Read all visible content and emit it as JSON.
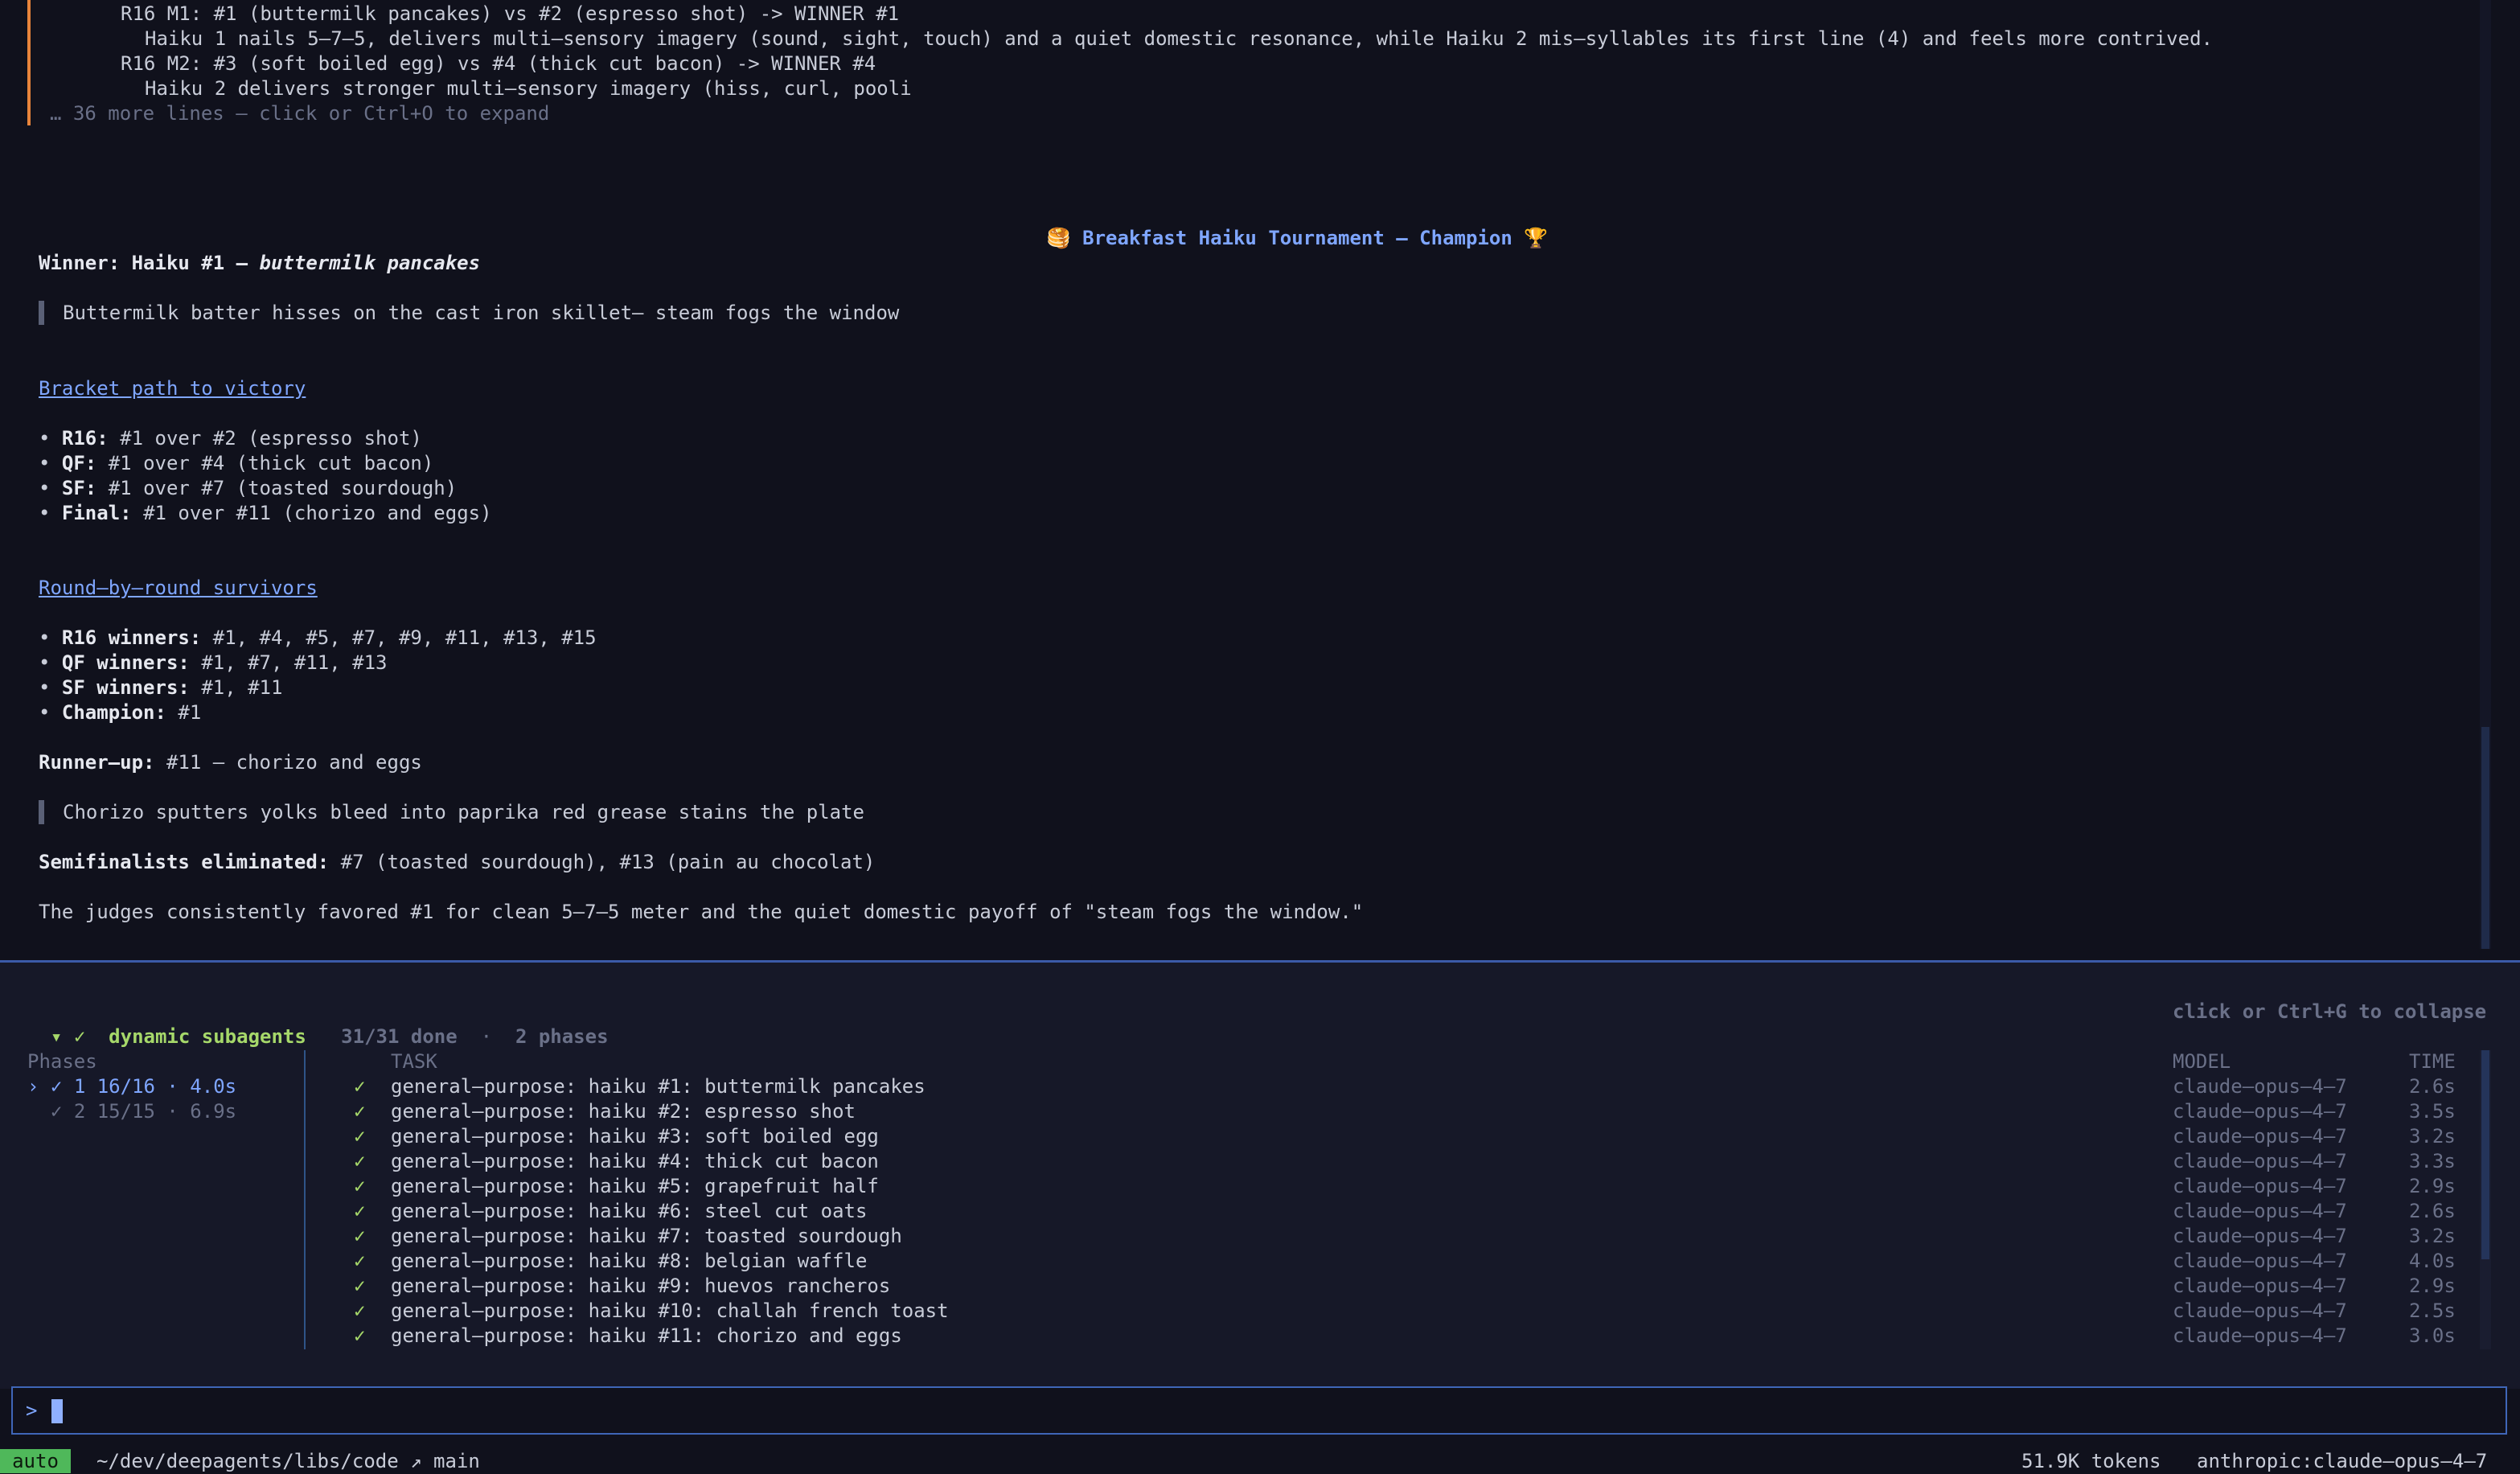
{
  "transcript": {
    "judge_lines": [
      "R16 M1: #1 (buttermilk pancakes) vs #2 (espresso shot) -> WINNER #1",
      "Haiku 1 nails 5–7–5, delivers multi–sensory imagery (sound, sight, touch) and a quiet domestic resonance, while Haiku 2 mis–syllables its first line (4) and feels more contrived.",
      "R16 M2: #3 (soft boiled egg) vs #4 (thick cut bacon) -> WINNER #4",
      "Haiku 2 delivers stronger multi–sensory imagery (hiss, curl, pooli"
    ],
    "collapsed_hint": "… 36 more lines — click or Ctrl+O to expand",
    "title_icon_left": "🥞",
    "title": "Breakfast Haiku Tournament — Champion",
    "title_icon_right": "🏆",
    "winner_label": "Winner: Haiku #1 —",
    "winner_name": "buttermilk pancakes",
    "winner_haiku": "Buttermilk batter hisses on the cast iron skillet— steam fogs the window",
    "bracket_heading": "Bracket path to victory",
    "bracket": [
      {
        "label": "R16:",
        "text": "#1 over #2 (espresso shot)"
      },
      {
        "label": "QF:",
        "text": "#1 over #4 (thick cut bacon)"
      },
      {
        "label": "SF:",
        "text": "#1 over #7 (toasted sourdough)"
      },
      {
        "label": "Final:",
        "text": "#1 over #11 (chorizo and eggs)"
      }
    ],
    "survivors_heading": "Round–by–round survivors",
    "survivors": [
      {
        "label": "R16 winners:",
        "text": "#1, #4, #5, #7, #9, #11, #13, #15"
      },
      {
        "label": "QF winners:",
        "text": "#1, #7, #11, #13"
      },
      {
        "label": "SF winners:",
        "text": "#1, #11"
      },
      {
        "label": "Champion:",
        "text": "#1"
      }
    ],
    "runner_up_label": "Runner–up:",
    "runner_up_text": "#11 — chorizo and eggs",
    "runner_up_haiku": "Chorizo sputters yolks bleed into paprika red grease stains the plate",
    "semis_label": "Semifinalists eliminated:",
    "semis_text": "#7 (toasted sourdough), #13 (pain au chocolat)",
    "closing": "The judges consistently favored #1 for clean 5–7–5 meter and the quiet domestic payoff of \"steam fogs the window.\""
  },
  "panel": {
    "header_arrow": "▾",
    "header_check": "✓",
    "header_title": "dynamic subagents",
    "header_done": "31/31 done",
    "header_sep": "·",
    "header_phases": "2 phases",
    "collapse_hint": "click or Ctrl+G to collapse",
    "phases_heading": "Phases",
    "phases": [
      {
        "marker": "›",
        "check": "✓",
        "text": "1 16/16 · 4.0s"
      },
      {
        "marker": "",
        "check": "✓",
        "text": "2 15/15 · 6.9s"
      }
    ],
    "col_task": "TASK",
    "col_model": "MODEL",
    "col_time": "TIME",
    "tasks": [
      {
        "check": "✓",
        "task": "general–purpose: haiku #1: buttermilk pancakes",
        "model": "claude–opus–4–7",
        "time": "2.6s"
      },
      {
        "check": "✓",
        "task": "general–purpose: haiku #2: espresso shot",
        "model": "claude–opus–4–7",
        "time": "3.5s"
      },
      {
        "check": "✓",
        "task": "general–purpose: haiku #3: soft boiled egg",
        "model": "claude–opus–4–7",
        "time": "3.2s"
      },
      {
        "check": "✓",
        "task": "general–purpose: haiku #4: thick cut bacon",
        "model": "claude–opus–4–7",
        "time": "3.3s"
      },
      {
        "check": "✓",
        "task": "general–purpose: haiku #5: grapefruit half",
        "model": "claude–opus–4–7",
        "time": "2.9s"
      },
      {
        "check": "✓",
        "task": "general–purpose: haiku #6: steel cut oats",
        "model": "claude–opus–4–7",
        "time": "2.6s"
      },
      {
        "check": "✓",
        "task": "general–purpose: haiku #7: toasted sourdough",
        "model": "claude–opus–4–7",
        "time": "3.2s"
      },
      {
        "check": "✓",
        "task": "general–purpose: haiku #8: belgian waffle",
        "model": "claude–opus–4–7",
        "time": "4.0s"
      },
      {
        "check": "✓",
        "task": "general–purpose: haiku #9: huevos rancheros",
        "model": "claude–opus–4–7",
        "time": "2.9s"
      },
      {
        "check": "✓",
        "task": "general–purpose: haiku #10: challah french toast",
        "model": "claude–opus–4–7",
        "time": "2.5s"
      },
      {
        "check": "✓",
        "task": "general–purpose: haiku #11: chorizo and eggs",
        "model": "claude–opus–4–7",
        "time": "3.0s"
      }
    ]
  },
  "input": {
    "prompt": ">"
  },
  "status": {
    "mode": "auto",
    "path": "~/dev/deepagents/libs/code",
    "branch_icon": "↗",
    "branch": "main",
    "tokens": "51.9K tokens",
    "model": "anthropic:claude–opus–4–7"
  }
}
